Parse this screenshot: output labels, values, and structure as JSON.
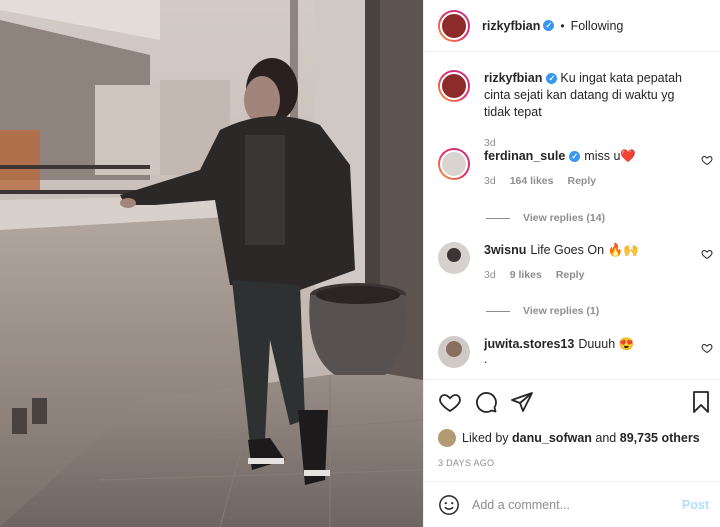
{
  "post": {
    "author": "rizkyfbian",
    "separator": "•",
    "follow_status": "Following"
  },
  "caption": {
    "author": "rizkyfbian",
    "text": "Ku ingat kata pepatah cinta sejati kan datang di waktu yg tidak tepat",
    "time": "3d"
  },
  "comments": [
    {
      "author": "ferdinan_sule",
      "text": "miss u",
      "emoji": "❤️",
      "time": "3d",
      "likes": "164 likes",
      "reply": "Reply",
      "view_replies": "View replies (14)"
    },
    {
      "author": "3wisnu",
      "text": "Life Goes On",
      "emoji": "🔥🙌",
      "time": "3d",
      "likes": "9 likes",
      "reply": "Reply",
      "view_replies": "View replies (1)"
    },
    {
      "author": "juwita.stores13",
      "text": "Duuuh",
      "emoji": "😍",
      "extra": "."
    }
  ],
  "likes": {
    "prefix": "Liked by",
    "user": "danu_sofwan",
    "and": "and",
    "others": "89,735 others"
  },
  "date": "3 DAYS AGO",
  "add_comment": {
    "placeholder": "Add a comment...",
    "post_label": "Post"
  },
  "icons": [
    "heart-icon",
    "comment-icon",
    "share-icon",
    "bookmark-icon",
    "emoji-icon",
    "verified-icon"
  ],
  "colors": {
    "link_blue": "#3897f0",
    "post_disabled": "#b2dffc",
    "muted": "#8e8e8e",
    "text": "#262626"
  }
}
